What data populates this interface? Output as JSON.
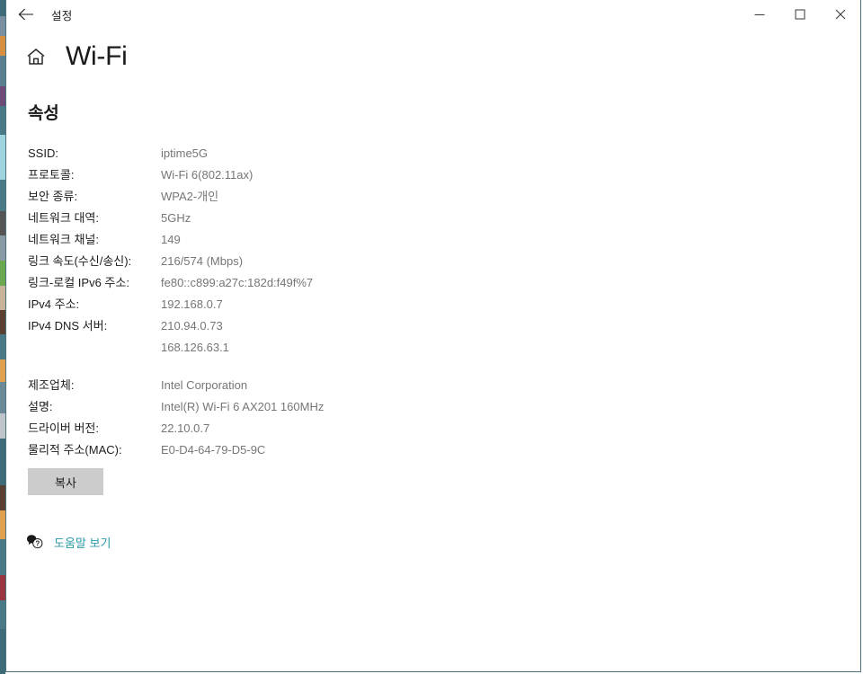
{
  "titlebar": {
    "app_title": "설정",
    "back_icon": "back-arrow-icon",
    "minimize_label": "─",
    "maximize_label": "□",
    "close_label": "✕"
  },
  "page": {
    "home_icon": "home-icon",
    "title": "Wi-Fi",
    "section_title": "속성"
  },
  "properties": [
    {
      "rows": [
        {
          "label": "SSID:",
          "values": [
            "iptime5G"
          ]
        },
        {
          "label": "프로토콜:",
          "values": [
            "Wi-Fi 6(802.11ax)"
          ]
        },
        {
          "label": "보안 종류:",
          "values": [
            "WPA2-개인"
          ]
        },
        {
          "label": "네트워크 대역:",
          "values": [
            "5GHz"
          ]
        },
        {
          "label": "네트워크 채널:",
          "values": [
            "149"
          ]
        },
        {
          "label": "링크 속도(수신/송신):",
          "values": [
            "216/574 (Mbps)"
          ]
        },
        {
          "label": "링크-로컬 IPv6 주소:",
          "values": [
            "fe80::c899:a27c:182d:f49f%7"
          ]
        },
        {
          "label": "IPv4 주소:",
          "values": [
            "192.168.0.7"
          ]
        },
        {
          "label": "IPv4 DNS 서버:",
          "values": [
            "210.94.0.73",
            "168.126.63.1"
          ]
        }
      ]
    },
    {
      "rows": [
        {
          "label": "제조업체:",
          "values": [
            "Intel Corporation"
          ]
        },
        {
          "label": "설명:",
          "values": [
            "Intel(R) Wi-Fi 6 AX201 160MHz"
          ]
        },
        {
          "label": "드라이버 버전:",
          "values": [
            "22.10.0.7"
          ]
        },
        {
          "label": "물리적 주소(MAC):",
          "values": [
            "E0-D4-64-79-D5-9C"
          ]
        }
      ]
    }
  ],
  "copy_button": {
    "label": "복사"
  },
  "help": {
    "icon": "help-bubble-icon",
    "label": "도움말 보기"
  },
  "colors": {
    "link": "#2b9aa9",
    "window_border": "#4a7480",
    "button_face": "#cccccc",
    "value_text": "#767676"
  }
}
